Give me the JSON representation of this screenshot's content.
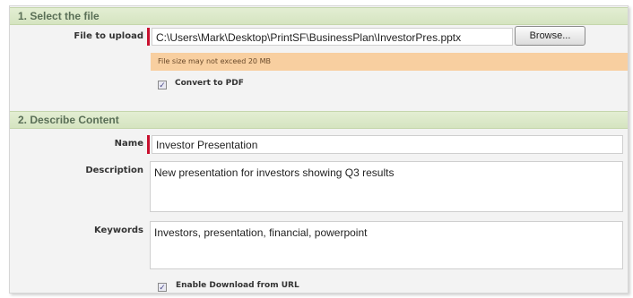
{
  "section1": {
    "title": "1. Select the file",
    "file_label": "File to upload",
    "file_value": "C:\\Users\\Mark\\Desktop\\PrintSF\\BusinessPlan\\InvestorPres.pptx",
    "browse_label": "Browse...",
    "size_warning": "File size may not exceed 20 MB",
    "convert_label": "Convert to PDF",
    "convert_checked": true
  },
  "section2": {
    "title": "2. Describe Content",
    "name_label": "Name",
    "name_value": "Investor Presentation",
    "description_label": "Description",
    "description_value": "New presentation for investors showing Q3 results",
    "keywords_label": "Keywords",
    "keywords_value": "Investors, presentation, financial, powerpoint",
    "download_label": "Enable Download from URL",
    "download_checked": true
  },
  "colors": {
    "header_bg": "#d5e4c0",
    "header_text": "#5a6f57",
    "required_bar": "#c8102e",
    "warning_bg": "#f8cfa0"
  },
  "icons": {
    "check": "✓"
  }
}
